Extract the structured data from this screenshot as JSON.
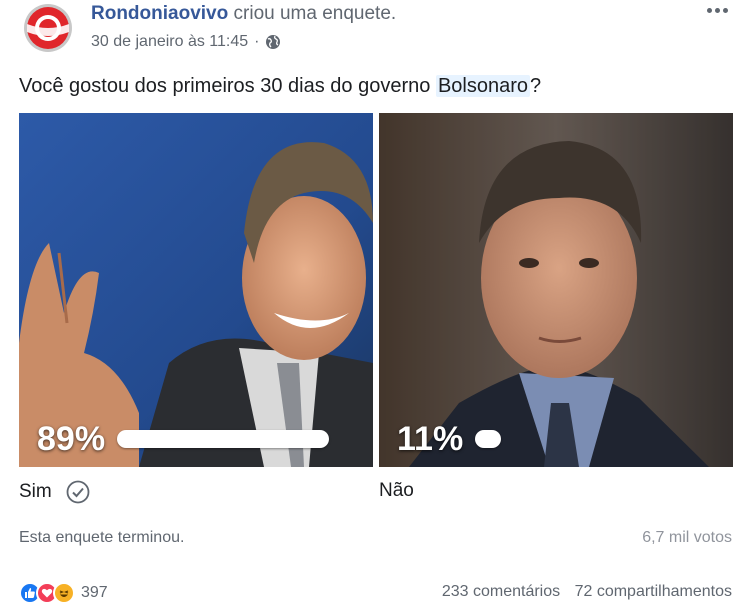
{
  "header": {
    "author": "Rondoniaovivo",
    "action": "criou uma enquete.",
    "timestamp": "30 de janeiro às 11:45",
    "separator": "·",
    "privacy_icon": "globe-icon",
    "menu_icon": "more-options-icon"
  },
  "question": {
    "prefix": "Você gostou dos primeiros 30 dias do governo ",
    "hashtag": "Bolsonaro",
    "suffix": "?"
  },
  "options": [
    {
      "label": "Sim",
      "percent_label": "89%",
      "percent": 89,
      "selected": true,
      "icon": "checkmark-icon"
    },
    {
      "label": "Não",
      "percent_label": "11%",
      "percent": 11,
      "selected": false
    }
  ],
  "footer": {
    "status": "Esta enquete terminou.",
    "votes": "6,7 mil votos",
    "reaction_count": "397",
    "reaction_icons": [
      "like-icon",
      "love-icon",
      "haha-icon"
    ],
    "comments": "233 comentários",
    "shares": "72 compartilhamentos"
  },
  "colors": {
    "author": "#365899",
    "secondary_text": "#606770",
    "hashtag_bg": "#e7f3ff",
    "like": "#1877f2",
    "love": "#f33e58",
    "haha": "#f7b125"
  }
}
